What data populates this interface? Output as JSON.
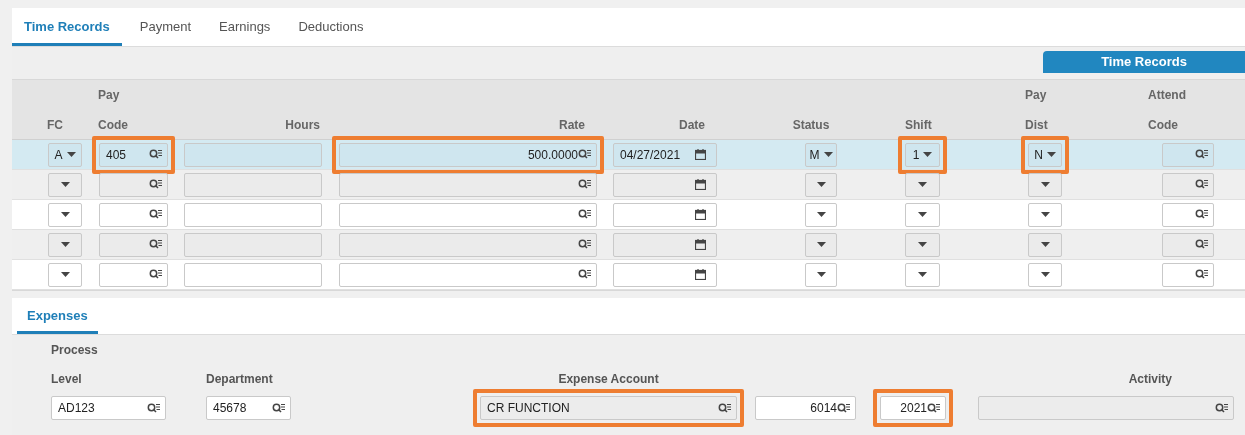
{
  "tabs": [
    {
      "label": "Time Records",
      "selected": true
    },
    {
      "label": "Payment",
      "selected": false
    },
    {
      "label": "Earnings",
      "selected": false
    },
    {
      "label": "Deductions",
      "selected": false
    }
  ],
  "toolbar_button": "Time Records",
  "columns": [
    {
      "label": "FC",
      "kind": "select"
    },
    {
      "top": "Pay",
      "label": "Code",
      "kind": "lookup"
    },
    {
      "label": "Hours",
      "kind": "text"
    },
    {
      "label": "Rate",
      "kind": "amount"
    },
    {
      "label": "Date",
      "kind": "date"
    },
    {
      "label": "Status",
      "kind": "select"
    },
    {
      "label": "Shift",
      "kind": "select"
    },
    {
      "top": "Pay",
      "label": "Dist",
      "kind": "select"
    },
    {
      "top": "Attend",
      "label": "Code",
      "kind": "lookup"
    }
  ],
  "rows": [
    {
      "selected": true,
      "cells": [
        "A",
        "405",
        null,
        "500.0000",
        "04/27/2021",
        "M",
        "1",
        "N",
        null
      ],
      "highlighted": [
        false,
        true,
        false,
        true,
        false,
        false,
        true,
        true,
        false
      ]
    },
    {
      "selected": false,
      "cells": [
        null,
        null,
        null,
        null,
        null,
        null,
        null,
        null,
        null
      ]
    },
    {
      "selected": false,
      "cells": [
        null,
        null,
        null,
        null,
        null,
        null,
        null,
        null,
        null
      ]
    },
    {
      "selected": false,
      "cells": [
        null,
        null,
        null,
        null,
        null,
        null,
        null,
        null,
        null
      ]
    },
    {
      "selected": false,
      "cells": [
        null,
        null,
        null,
        null,
        null,
        null,
        null,
        null,
        null
      ]
    }
  ],
  "expenses": {
    "tab": {
      "label": "Expenses",
      "selected": true
    },
    "fields": [
      {
        "top": "Process",
        "label": "Level",
        "value": "AD123",
        "highlighted": false
      },
      {
        "label": "Department",
        "value": "45678",
        "highlighted": false
      },
      {
        "label": "Expense Account",
        "value": "CR FUNCTION",
        "highlighted": true
      },
      {
        "value": "6014",
        "highlighted": false
      },
      {
        "value": "2021",
        "highlighted": true
      },
      {
        "label": "Activity",
        "highlighted": false
      }
    ]
  }
}
